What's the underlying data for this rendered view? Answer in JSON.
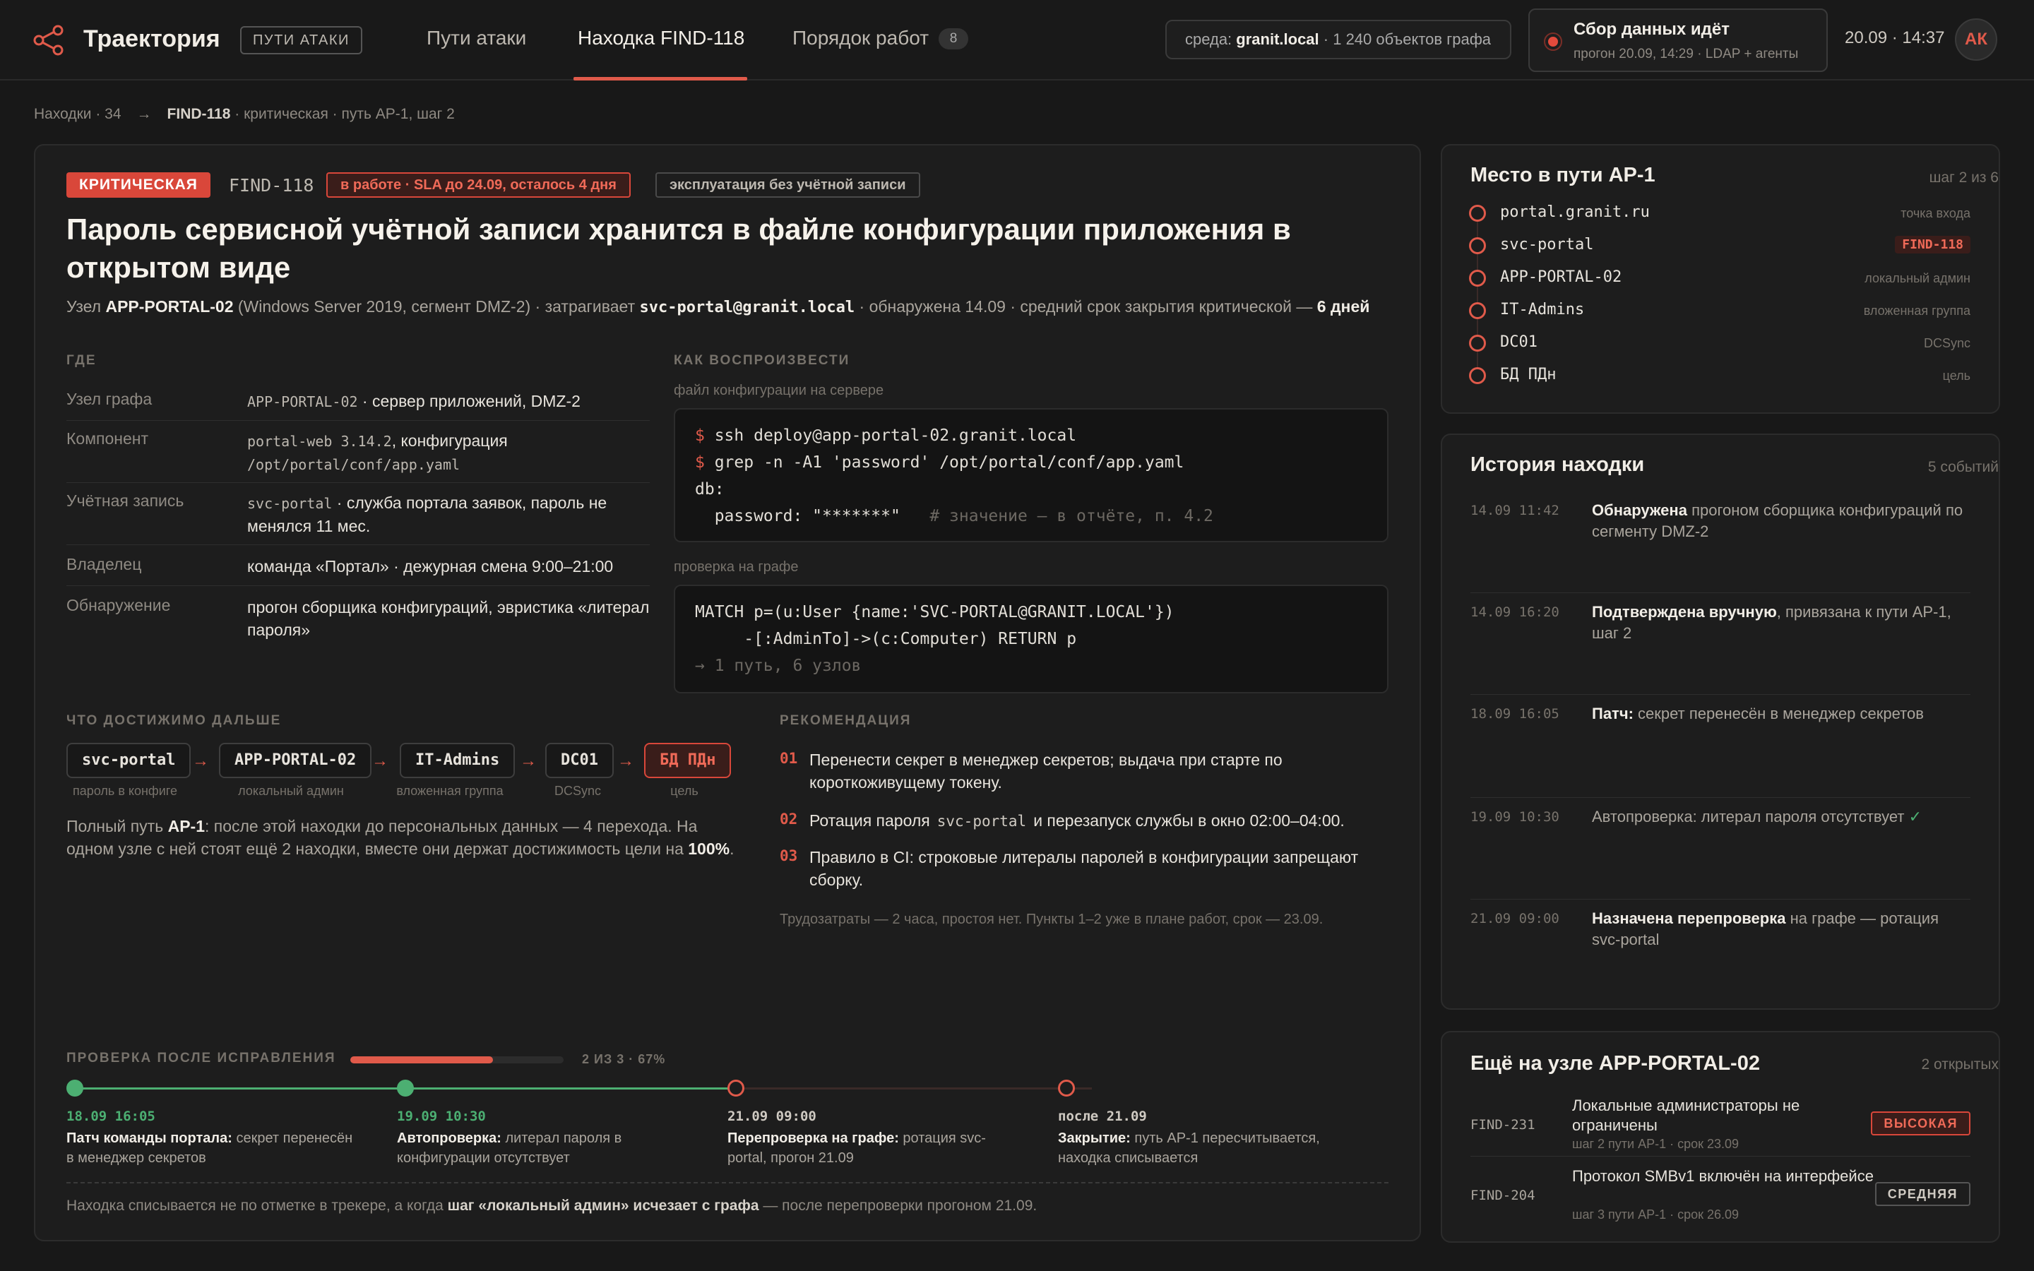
{
  "app": {
    "name": "Траектория",
    "tag": "ПУТИ АТАКИ"
  },
  "nav": {
    "tabs": [
      {
        "label": "Пути атаки"
      },
      {
        "label": "Находка FIND-118"
      },
      {
        "label": "Порядок работ",
        "count": "8"
      }
    ]
  },
  "env": {
    "prefix": "среда:",
    "name": "granit.local",
    "suffix": "· 1 240 объектов графа"
  },
  "collect": {
    "title": "Сбор данных идёт",
    "detail": "прогон 20.09, 14:29 · LDAP + агенты"
  },
  "clock": "20.09 · 14:37",
  "user": {
    "initials": "АК"
  },
  "breadcrumb": {
    "root": "Находки · 34",
    "current": "FIND-118",
    "rest": "· критическая · путь АР-1, шаг 2"
  },
  "finding": {
    "severity": "КРИТИЧЕСКАЯ",
    "id": "FIND-118",
    "sla": "в работе · SLA до 24.09, осталось 4 дня",
    "exploit": "эксплуатация без учётной записи",
    "title": "Пароль сервисной учётной записи хранится в файле конфигурации приложения в открытом виде",
    "sub": {
      "p1": "Узел ",
      "node": "APP-PORTAL-02",
      "p2": " (Windows Server 2019, сегмент DMZ-2) · затрагивает ",
      "account": "svc-portal@granit.local",
      "p3": " · обнаружена 14.09 · средний срок закрытия критической — ",
      "days": "6 дней"
    }
  },
  "where": {
    "label": "ГДЕ",
    "rows": [
      {
        "k": "Узел графа",
        "m": "APP-PORTAL-02",
        "v": " · сервер приложений, DMZ-2"
      },
      {
        "k": "Компонент",
        "m": "portal-web 3.14.2",
        "v": ", конфигурация",
        "m2": "/opt/portal/conf/app.yaml"
      },
      {
        "k": "Учётная запись",
        "m": "svc-portal",
        "v": " · служба портала заявок, пароль не менялся 11 мес."
      },
      {
        "k": "Владелец",
        "v": "команда «Портал» · дежурная смена 9:00–21:00"
      },
      {
        "k": "Обнаружение",
        "v": "прогон сборщика конфигураций, эвристика «литерал пароля»"
      }
    ]
  },
  "repro": {
    "label": "КАК ВОСПРОИЗВЕСТИ",
    "server_label": "файл конфигурации на сервере",
    "server_lines": [
      {
        "prompt": "$",
        "text": " ssh deploy@app-portal-02.granit.local"
      },
      {
        "prompt": "$",
        "text": " grep -n -A1 'password' /opt/portal/conf/app.yaml"
      },
      {
        "text": "db:"
      },
      {
        "text": "  password: \"*******\"",
        "comment": "   # значение — в отчёте, п. 4.2"
      }
    ],
    "graph_label": "проверка на графе",
    "graph_lines": [
      {
        "text": "MATCH p=(u:User {name:'SVC-PORTAL@GRANIT.LOCAL'})"
      },
      {
        "text": "     -[:AdminTo]->(c:Computer) RETURN p"
      },
      {
        "comment": "→ 1 путь, 6 узлов"
      }
    ]
  },
  "reach": {
    "label": "ЧТО ДОСТИЖИМО ДАЛЬШЕ",
    "chain": [
      {
        "name": "svc-portal",
        "cap": "пароль в конфиге"
      },
      {
        "name": "APP-PORTAL-02",
        "cap": "локальный админ"
      },
      {
        "name": "IT-Admins",
        "cap": "вложенная группа"
      },
      {
        "name": "DC01",
        "cap": "DCSync"
      },
      {
        "name": "БД ПДн",
        "cap": "цель"
      }
    ],
    "text": {
      "p1": "Полный путь ",
      "path": "АР-1",
      "p2": ": после этой находки до персональных данных — 4 перехода. На одном узле с ней стоят ещё 2 находки, вместе они держат достижимость цели на ",
      "pct": "100%",
      "p3": "."
    }
  },
  "recommend": {
    "label": "РЕКОМЕНДАЦИЯ",
    "items": [
      {
        "n": "01",
        "t": "Перенести секрет в менеджер секретов; выдача при старте по короткоживущему токену."
      },
      {
        "n": "02",
        "t1": "Ротация пароля",
        "m": "svc-portal",
        "t2": "и перезапуск службы в окно 02:00–04:00."
      },
      {
        "n": "03",
        "t": "Правило в CI: строковые литералы паролей в конфигурации запрещают сборку."
      }
    ],
    "effort": "Трудозатраты — 2 часа, простоя нет. Пункты 1–2 уже в плане работ, срок — 23.09."
  },
  "verify": {
    "label": "ПРОВЕРКА ПОСЛЕ ИСПРАВЛЕНИЯ",
    "progress_text": "2 ИЗ 3 · 67%",
    "progress": 0.67,
    "steps": [
      {
        "date": "18.09 16:05",
        "b": "Патч команды портала:",
        "t": " секрет перенесён в менеджер секретов",
        "done": true
      },
      {
        "date": "19.09 10:30",
        "b": "Автопроверка:",
        "t": " литерал пароля в конфигурации отсутствует",
        "done": true
      },
      {
        "date": "21.09 09:00",
        "b": "Перепроверка на графе:",
        "t": " ротация svc-portal, прогон 21.09",
        "done": false
      },
      {
        "date": "после 21.09",
        "b": "Закрытие:",
        "t": " путь АР-1 пересчитывается, находка списывается",
        "done": false
      }
    ],
    "footnote": {
      "p1": "Находка списывается не по отметке в трекере, а когда ",
      "b": "шаг «локальный админ» исчезает с графа",
      "p2": " — после перепроверки прогоном 21.09."
    }
  },
  "path_panel": {
    "title": "Место в пути АР-1",
    "meta": "шаг 2 из 6",
    "nodes": [
      {
        "name": "portal.granit.ru",
        "role": "точка входа"
      },
      {
        "name": "svc-portal",
        "role": "FIND-118",
        "current": true
      },
      {
        "name": "APP-PORTAL-02",
        "role": "локальный админ"
      },
      {
        "name": "IT-Admins",
        "role": "вложенная группа"
      },
      {
        "name": "DC01",
        "role": "DCSync"
      },
      {
        "name": "БД ПДн",
        "role": "цель"
      }
    ]
  },
  "history": {
    "title": "История находки",
    "meta": "5 событий",
    "events": [
      {
        "d": "14.09 11:42",
        "b": "Обнаружена",
        "t": " прогоном сборщика конфигураций по сегменту DMZ-2"
      },
      {
        "d": "14.09 16:20",
        "b": "Подтверждена вручную",
        "t": ", привязана к пути АР-1, шаг 2"
      },
      {
        "d": "18.09 16:05",
        "b": "Патч:",
        "t": " секрет перенесён в менеджер секретов"
      },
      {
        "d": "19.09 10:30",
        "b": "",
        "t": "Автопроверка: литерал пароля отсутствует",
        "check": "✓"
      },
      {
        "d": "21.09 09:00",
        "b": "Назначена перепроверка",
        "t": " на графе — ротация svc-portal"
      }
    ]
  },
  "others": {
    "title": "Ещё на узле APP-PORTAL-02",
    "meta": "2 открытых",
    "items": [
      {
        "id": "FIND-231",
        "t1": "Локальные администраторы не ограничены",
        "t2": "шаг 2 пути АР-1 · срок 23.09",
        "sev": "ВЫСОКАЯ",
        "level": "high"
      },
      {
        "id": "FIND-204",
        "t1": "Протокол SMBv1 включён на интерфейсе",
        "t2": "шаг 3 пути АР-1 · срок 26.09",
        "sev": "СРЕДНЯЯ",
        "level": "mid"
      }
    ]
  },
  "colors": {
    "accent": "#e05a4a",
    "done": "#4caf72",
    "bg": "#181818",
    "panel": "#1d1d1d"
  }
}
